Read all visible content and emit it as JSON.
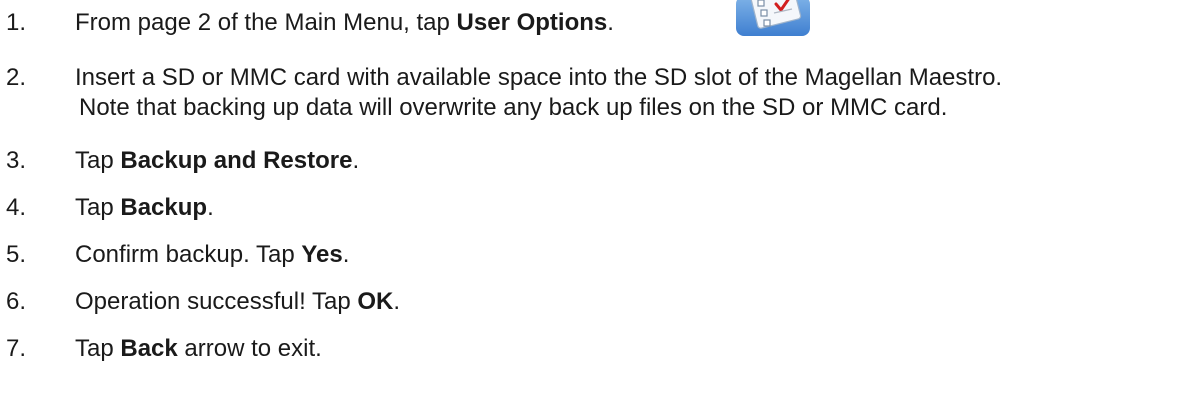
{
  "steps": [
    {
      "num": "1.",
      "pre": "From page 2 of the Main Menu, tap ",
      "bold": "User Options",
      "post": "."
    },
    {
      "num": "2.",
      "line1": "Insert a SD or MMC card with available space into the SD slot of the Magellan Maestro.",
      "line2": "Note that backing up data will overwrite any back up files on the SD or MMC card."
    },
    {
      "num": "3.",
      "pre": "Tap ",
      "bold": "Backup and Restore",
      "post": "."
    },
    {
      "num": "4.",
      "pre": "Tap ",
      "bold": "Backup",
      "post": "."
    },
    {
      "num": "5.",
      "pre": "Confirm backup.  Tap ",
      "bold": "Yes",
      "post": "."
    },
    {
      "num": "6.",
      "pre": "Operation successful!  Tap ",
      "bold": "OK",
      "post": "."
    },
    {
      "num": "7.",
      "pre": "Tap ",
      "bold": "Back",
      "post": " arrow to exit."
    }
  ],
  "icons": {
    "user_options": "user-options-checklist-icon"
  },
  "colors": {
    "icon_tile": "#3f7fd0",
    "checkmark": "#d21f1f"
  }
}
